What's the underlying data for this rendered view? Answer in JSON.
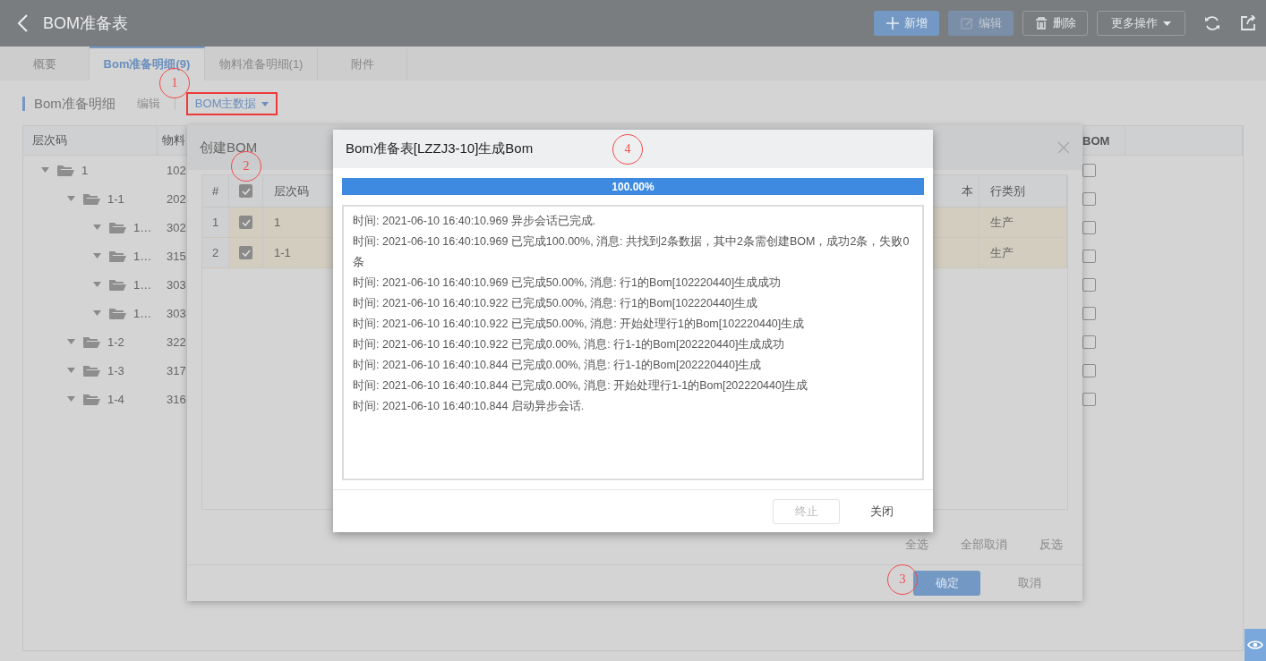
{
  "header": {
    "title": "BOM准备表",
    "buttons": [
      {
        "label": "新增",
        "kind": "primary"
      },
      {
        "label": "编辑",
        "kind": "disabled"
      },
      {
        "label": "删除",
        "kind": "outline"
      },
      {
        "label": "更多操作",
        "kind": "dropdown"
      }
    ]
  },
  "tabs": [
    {
      "label": "概要",
      "selected": false
    },
    {
      "label": "Bom准备明细(9)",
      "selected": true
    },
    {
      "label": "物料准备明细(1)",
      "selected": false
    },
    {
      "label": "附件",
      "selected": false
    }
  ],
  "section": {
    "title": "Bom准备明细",
    "edit": "编辑",
    "data_menu": "BOM主数据"
  },
  "tree_table": {
    "columns": [
      "层次码",
      "物料",
      "BOM"
    ],
    "rows": [
      {
        "code": "1",
        "column_2": "102",
        "expanded": true,
        "checked": false,
        "children": [
          {
            "code": "1-1",
            "column_2": "202",
            "expanded": true,
            "checked": false,
            "children": [
              {
                "code": "1…",
                "column_2": "302",
                "expanded": true,
                "checked": false
              },
              {
                "code": "1…",
                "column_2": "315",
                "expanded": true,
                "checked": false
              },
              {
                "code": "1…",
                "column_2": "303",
                "expanded": true,
                "checked": false
              },
              {
                "code": "1…",
                "column_2": "303",
                "expanded": true,
                "checked": false
              }
            ]
          },
          {
            "code": "1-2",
            "column_2": "322",
            "expanded": true,
            "checked": false
          },
          {
            "code": "1-3",
            "column_2": "317",
            "expanded": true,
            "checked": false
          },
          {
            "code": "1-4",
            "column_2": "316",
            "expanded": true,
            "checked": false
          }
        ]
      }
    ]
  },
  "create_dialog": {
    "title": "创建BOM",
    "columns": {
      "index": "#",
      "code": "层次码",
      "version": "本",
      "line_type": "行类别"
    },
    "all_checked": true,
    "rows": [
      {
        "index": "1",
        "checked": true,
        "code": "1",
        "line_type": "生产"
      },
      {
        "index": "2",
        "checked": true,
        "code": "1-1",
        "line_type": "生产"
      }
    ],
    "select_actions": [
      "全选",
      "全部取消",
      "反选"
    ],
    "buttons": [
      {
        "label": "确定",
        "kind": "primary"
      },
      {
        "label": "取消",
        "kind": "text"
      }
    ]
  },
  "progress_dialog": {
    "title": "Bom准备表[LZZJ3-10]生成Bom",
    "progress": {
      "level": 1,
      "label": "100.00%"
    },
    "log": [
      "时间: 2021-06-10 16:40:10.969 异步会话已完成.",
      "时间: 2021-06-10 16:40:10.969 已完成100.00%, 消息: 共找到2条数据，其中2条需创建BOM，成功2条，失败0条",
      "时间: 2021-06-10 16:40:10.969 已完成50.00%, 消息: 行1的Bom[102220440]生成成功",
      "时间: 2021-06-10 16:40:10.922 已完成50.00%, 消息: 行1的Bom[102220440]生成",
      "时间: 2021-06-10 16:40:10.922 已完成50.00%, 消息: 开始处理行1的Bom[102220440]生成",
      "时间: 2021-06-10 16:40:10.922 已完成0.00%, 消息: 行1-1的Bom[202220440]生成成功",
      "时间: 2021-06-10 16:40:10.844 已完成0.00%, 消息: 行1-1的Bom[202220440]生成",
      "时间: 2021-06-10 16:40:10.844 已完成0.00%, 消息: 开始处理行1-1的Bom[202220440]生成",
      "时间: 2021-06-10 16:40:10.844 启动异步会话."
    ],
    "buttons": [
      {
        "label": "终止",
        "kind": "disabled"
      },
      {
        "label": "关闭",
        "kind": "text"
      }
    ]
  },
  "annotations": [
    {
      "label": "1"
    },
    {
      "label": "2"
    },
    {
      "label": "3"
    },
    {
      "label": "4"
    }
  ]
}
